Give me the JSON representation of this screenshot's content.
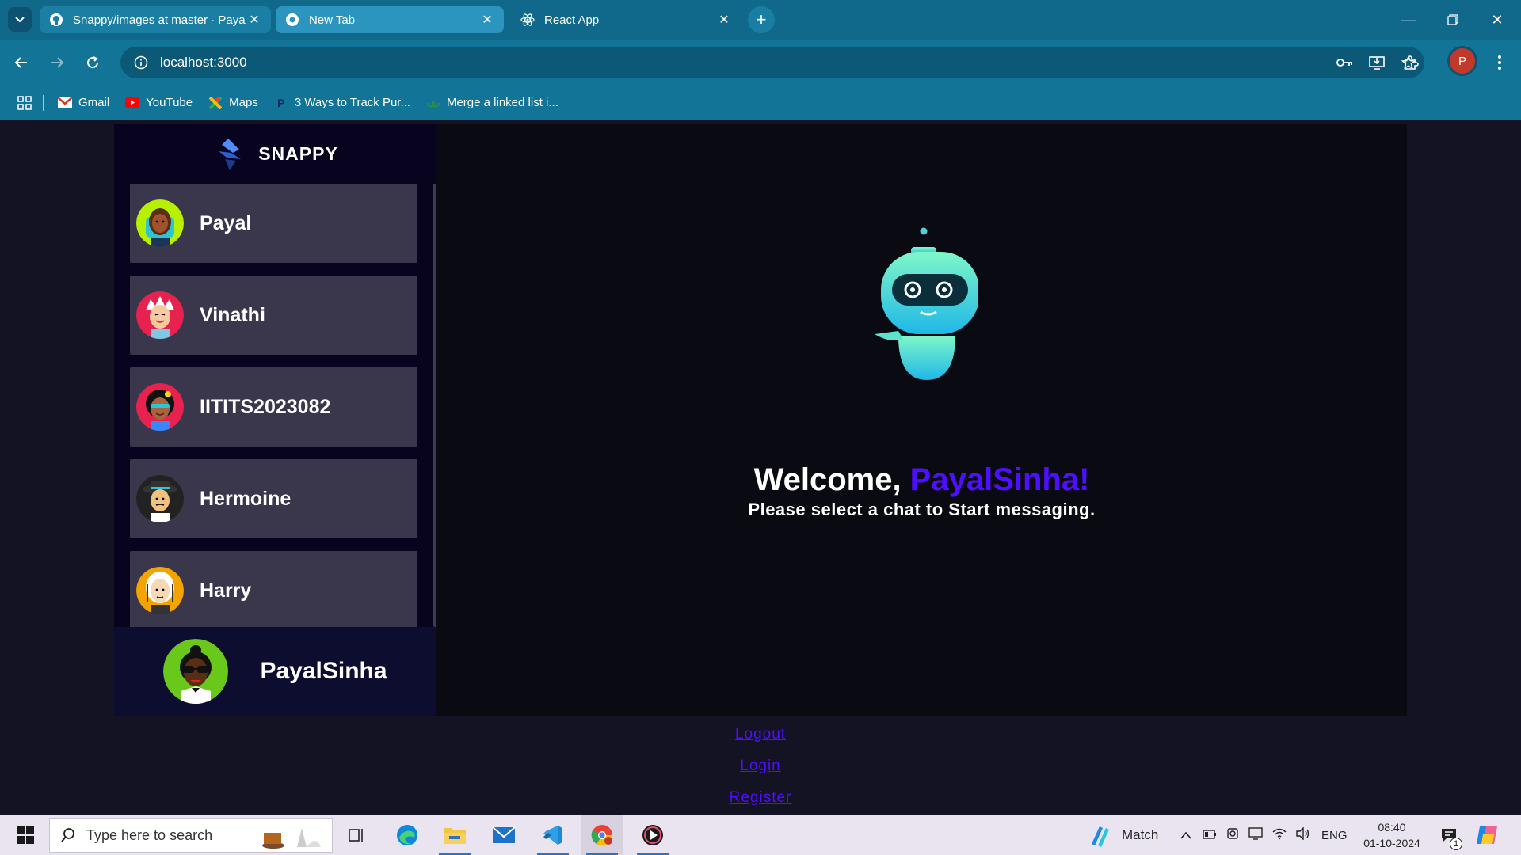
{
  "browser": {
    "tabs": [
      {
        "title": "Snappy/images at master · Paya",
        "icon": "github-icon"
      },
      {
        "title": "New Tab",
        "icon": "chrome-icon"
      },
      {
        "title": "React App",
        "icon": "react-icon"
      }
    ],
    "url": "localhost:3000",
    "profile_initial": "P",
    "bookmarks": [
      {
        "label": "Gmail",
        "icon": "gmail-icon"
      },
      {
        "label": "YouTube",
        "icon": "youtube-icon"
      },
      {
        "label": "Maps",
        "icon": "maps-icon"
      },
      {
        "label": "3 Ways to Track Pur...",
        "icon": "p-icon"
      },
      {
        "label": "Merge a linked list i...",
        "icon": "gfg-icon"
      }
    ]
  },
  "app": {
    "brand": "SNAPPY",
    "contacts": [
      {
        "name": "Payal"
      },
      {
        "name": "Vinathi"
      },
      {
        "name": "IITITS2023082"
      },
      {
        "name": "Hermoine"
      },
      {
        "name": "Harry"
      }
    ],
    "current_user": "PayalSinha",
    "welcome": {
      "prefix": "Welcome, ",
      "username": "PayalSinha!",
      "subtitle": "Please select a chat to Start messaging."
    },
    "links": {
      "logout": "Logout",
      "login": "Login",
      "register": "Register"
    },
    "colors": {
      "accent": "#4e0eff",
      "background": "#131324",
      "contact_card": "#ffffff34"
    }
  },
  "taskbar": {
    "search_placeholder": "Type here to search",
    "weather_label": "Match",
    "language": "ENG",
    "time": "08:40",
    "date": "01-10-2024",
    "notification_count": "1"
  }
}
